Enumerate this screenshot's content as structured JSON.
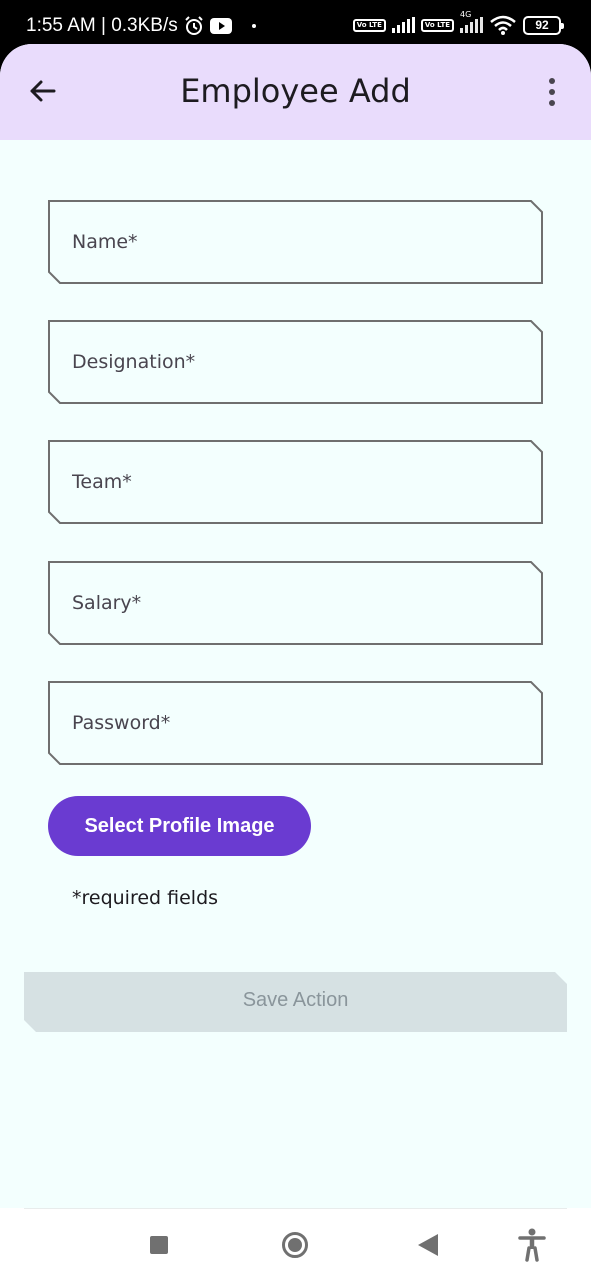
{
  "status_bar": {
    "time_speed": "1:55 AM | 0.3KB/s",
    "volte_label": "Vo LTE",
    "network_type": "4G",
    "battery": "92"
  },
  "app_bar": {
    "title": "Employee Add",
    "back_icon": "arrow-left-icon",
    "menu_icon": "more-vert-icon",
    "background": "#e9dcfc"
  },
  "form": {
    "fields": [
      {
        "placeholder": "Name*",
        "value": ""
      },
      {
        "placeholder": "Designation*",
        "value": ""
      },
      {
        "placeholder": "Team*",
        "value": ""
      },
      {
        "placeholder": "Salary*",
        "value": ""
      },
      {
        "placeholder": "Password*",
        "value": ""
      }
    ],
    "select_image_label": "Select Profile Image",
    "required_note": "*required fields",
    "save_label": "Save Action"
  },
  "colors": {
    "accent": "#6a3bd1",
    "screen_bg": "#f3fffe",
    "disabled_button": "#d6e1e3",
    "field_border": "#6f6f6f"
  }
}
